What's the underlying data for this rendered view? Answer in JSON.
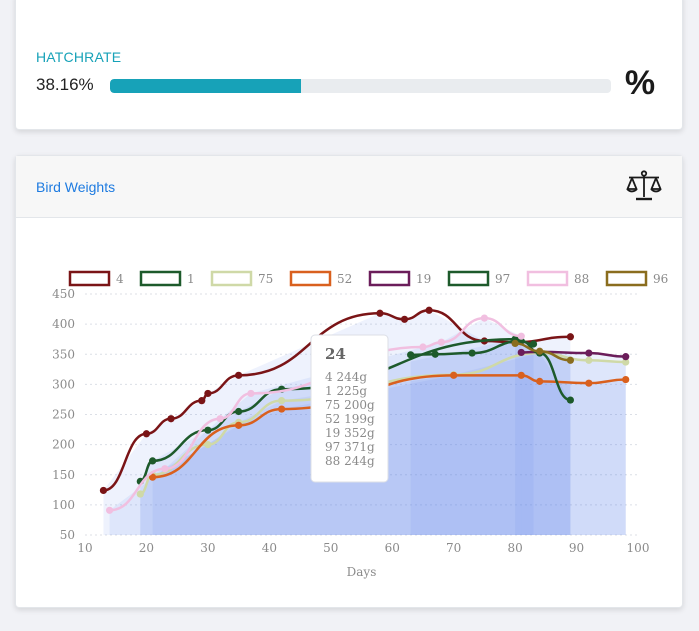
{
  "hatchrate": {
    "title": "HATCHRATE",
    "value_text": "38.16%",
    "progress": 0.3816,
    "icon": "percent-icon",
    "icon_glyph": "%"
  },
  "weights_card": {
    "title": "Bird Weights",
    "icon": "scale-icon"
  },
  "chart_data": {
    "type": "line",
    "xlabel": "Days",
    "ylabel": "",
    "xlim": [
      10,
      100
    ],
    "ylim": [
      50,
      450
    ],
    "x_ticks": [
      10,
      20,
      30,
      40,
      50,
      60,
      70,
      80,
      90,
      100
    ],
    "y_ticks": [
      50,
      100,
      150,
      200,
      250,
      300,
      350,
      400,
      450
    ],
    "grid": "horizontal dotted",
    "legend_position": "top",
    "series": [
      {
        "name": "4",
        "color": "#7a1416",
        "points": [
          [
            13,
            124
          ],
          [
            20,
            218
          ],
          [
            24,
            243
          ],
          [
            29,
            273
          ],
          [
            30,
            285
          ],
          [
            35,
            315
          ],
          [
            58,
            418
          ],
          [
            62,
            408
          ],
          [
            66,
            423
          ],
          [
            75,
            372
          ],
          [
            80,
            370
          ],
          [
            89,
            379
          ]
        ]
      },
      {
        "name": "1",
        "color": "#1d5a2b",
        "points": [
          [
            19,
            139
          ],
          [
            21,
            173
          ],
          [
            30,
            224
          ],
          [
            35,
            255
          ],
          [
            42,
            292
          ],
          [
            80,
            375
          ],
          [
            83,
            367
          ]
        ]
      },
      {
        "name": "75",
        "color": "#cfd9a7",
        "points": [
          [
            19,
            118
          ],
          [
            21,
            150
          ],
          [
            30,
            200
          ],
          [
            35,
            237
          ],
          [
            42,
            273
          ],
          [
            70,
            316
          ],
          [
            84,
            352
          ],
          [
            92,
            340
          ],
          [
            98,
            337
          ]
        ]
      },
      {
        "name": "52",
        "color": "#d9601e",
        "points": [
          [
            21,
            146
          ],
          [
            35,
            232
          ],
          [
            42,
            259
          ],
          [
            70,
            315
          ],
          [
            81,
            315
          ],
          [
            84,
            305
          ],
          [
            92,
            302
          ],
          [
            98,
            308
          ]
        ]
      },
      {
        "name": "19",
        "color": "#6b1d5a",
        "points": [
          [
            81,
            353
          ],
          [
            84,
            354
          ],
          [
            92,
            352
          ],
          [
            98,
            346
          ]
        ]
      },
      {
        "name": "97",
        "color": "#1d5a2b",
        "points": [
          [
            63,
            349
          ],
          [
            67,
            350
          ],
          [
            73,
            352
          ],
          [
            81,
            372
          ],
          [
            84,
            352
          ],
          [
            89,
            274
          ]
        ]
      },
      {
        "name": "88",
        "color": "#f1bfe0",
        "points": [
          [
            14,
            91
          ],
          [
            23,
            160
          ],
          [
            32,
            243
          ],
          [
            37,
            285
          ],
          [
            65,
            362
          ],
          [
            68,
            370
          ],
          [
            75,
            410
          ],
          [
            81,
            380
          ]
        ]
      },
      {
        "name": "96",
        "color": "#8a6d1e",
        "points": [
          [
            80,
            368
          ],
          [
            84,
            355
          ],
          [
            89,
            340
          ]
        ]
      }
    ],
    "tooltip": {
      "title": "24",
      "lines": [
        "4 244g",
        "1 225g",
        "75 200g",
        "52 199g",
        "19 352g",
        "97 371g",
        "88 244g"
      ]
    }
  }
}
